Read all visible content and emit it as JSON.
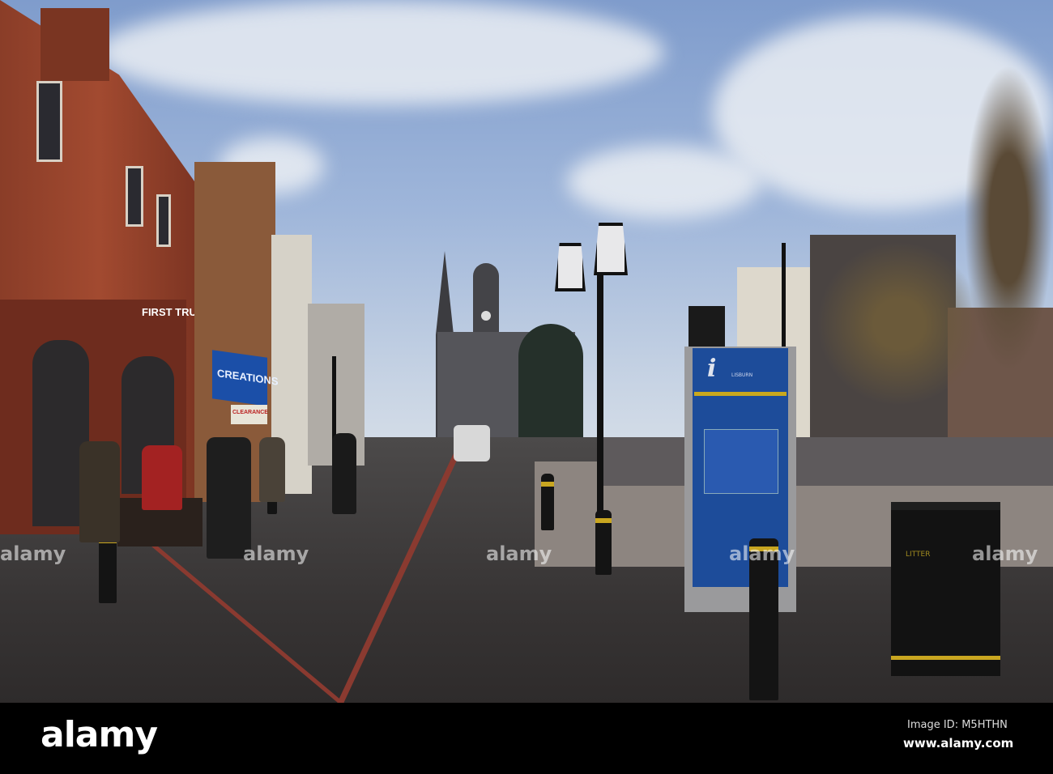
{
  "photo": {
    "shop_signs": {
      "bank": "FIRST TRUST",
      "store": "CREATIONS",
      "sale": "CLEARANCE"
    },
    "info_sign": {
      "icon": "i",
      "title": "LISBURN"
    },
    "bin_label": "LITTER"
  },
  "watermark": {
    "logo": "alamy",
    "repeated": "alamy"
  },
  "footer": {
    "logo": "alamy",
    "image_id": "Image ID: M5HTHN",
    "site": "www.alamy.com"
  }
}
